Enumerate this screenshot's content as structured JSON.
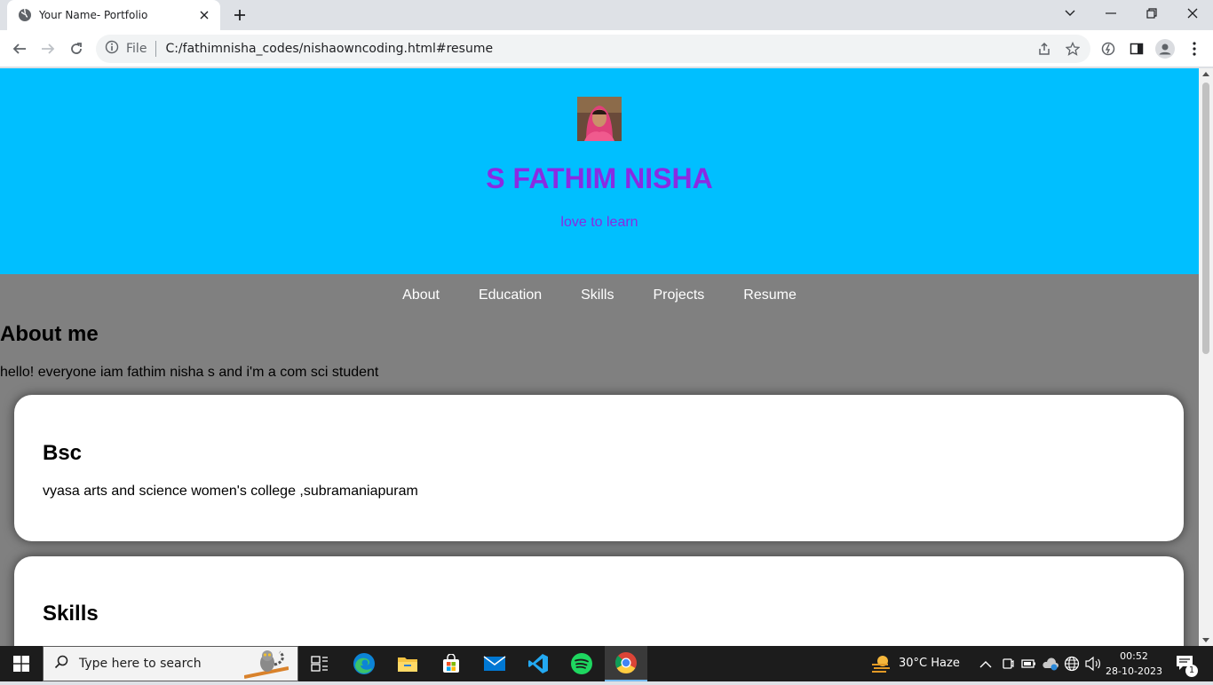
{
  "browser": {
    "tab_title": "Your Name- Portfolio",
    "address_prefix": "File",
    "url": "C:/fathimnisha_codes/nishaowncoding.html#resume"
  },
  "page": {
    "header": {
      "name": "S FATHIM NISHA",
      "tagline": "love to learn"
    },
    "nav": [
      "About",
      "Education",
      "Skills",
      "Projects",
      "Resume"
    ],
    "about": {
      "heading": "About me",
      "text": "hello! everyone iam fathim nisha s and i'm a com sci student"
    },
    "education_card": {
      "heading": "Bsc",
      "text": "vyasa arts and science women's college ,subramaniapuram"
    },
    "skills_card": {
      "heading": "Skills"
    },
    "colors": {
      "header_bg": "#00bfff",
      "title_color": "#8a2be2",
      "page_bg": "#808080"
    }
  },
  "taskbar": {
    "search_placeholder": "Type here to search",
    "weather": "30°C  Haze",
    "time": "00:52",
    "date": "28-10-2023",
    "notification_count": "1"
  }
}
